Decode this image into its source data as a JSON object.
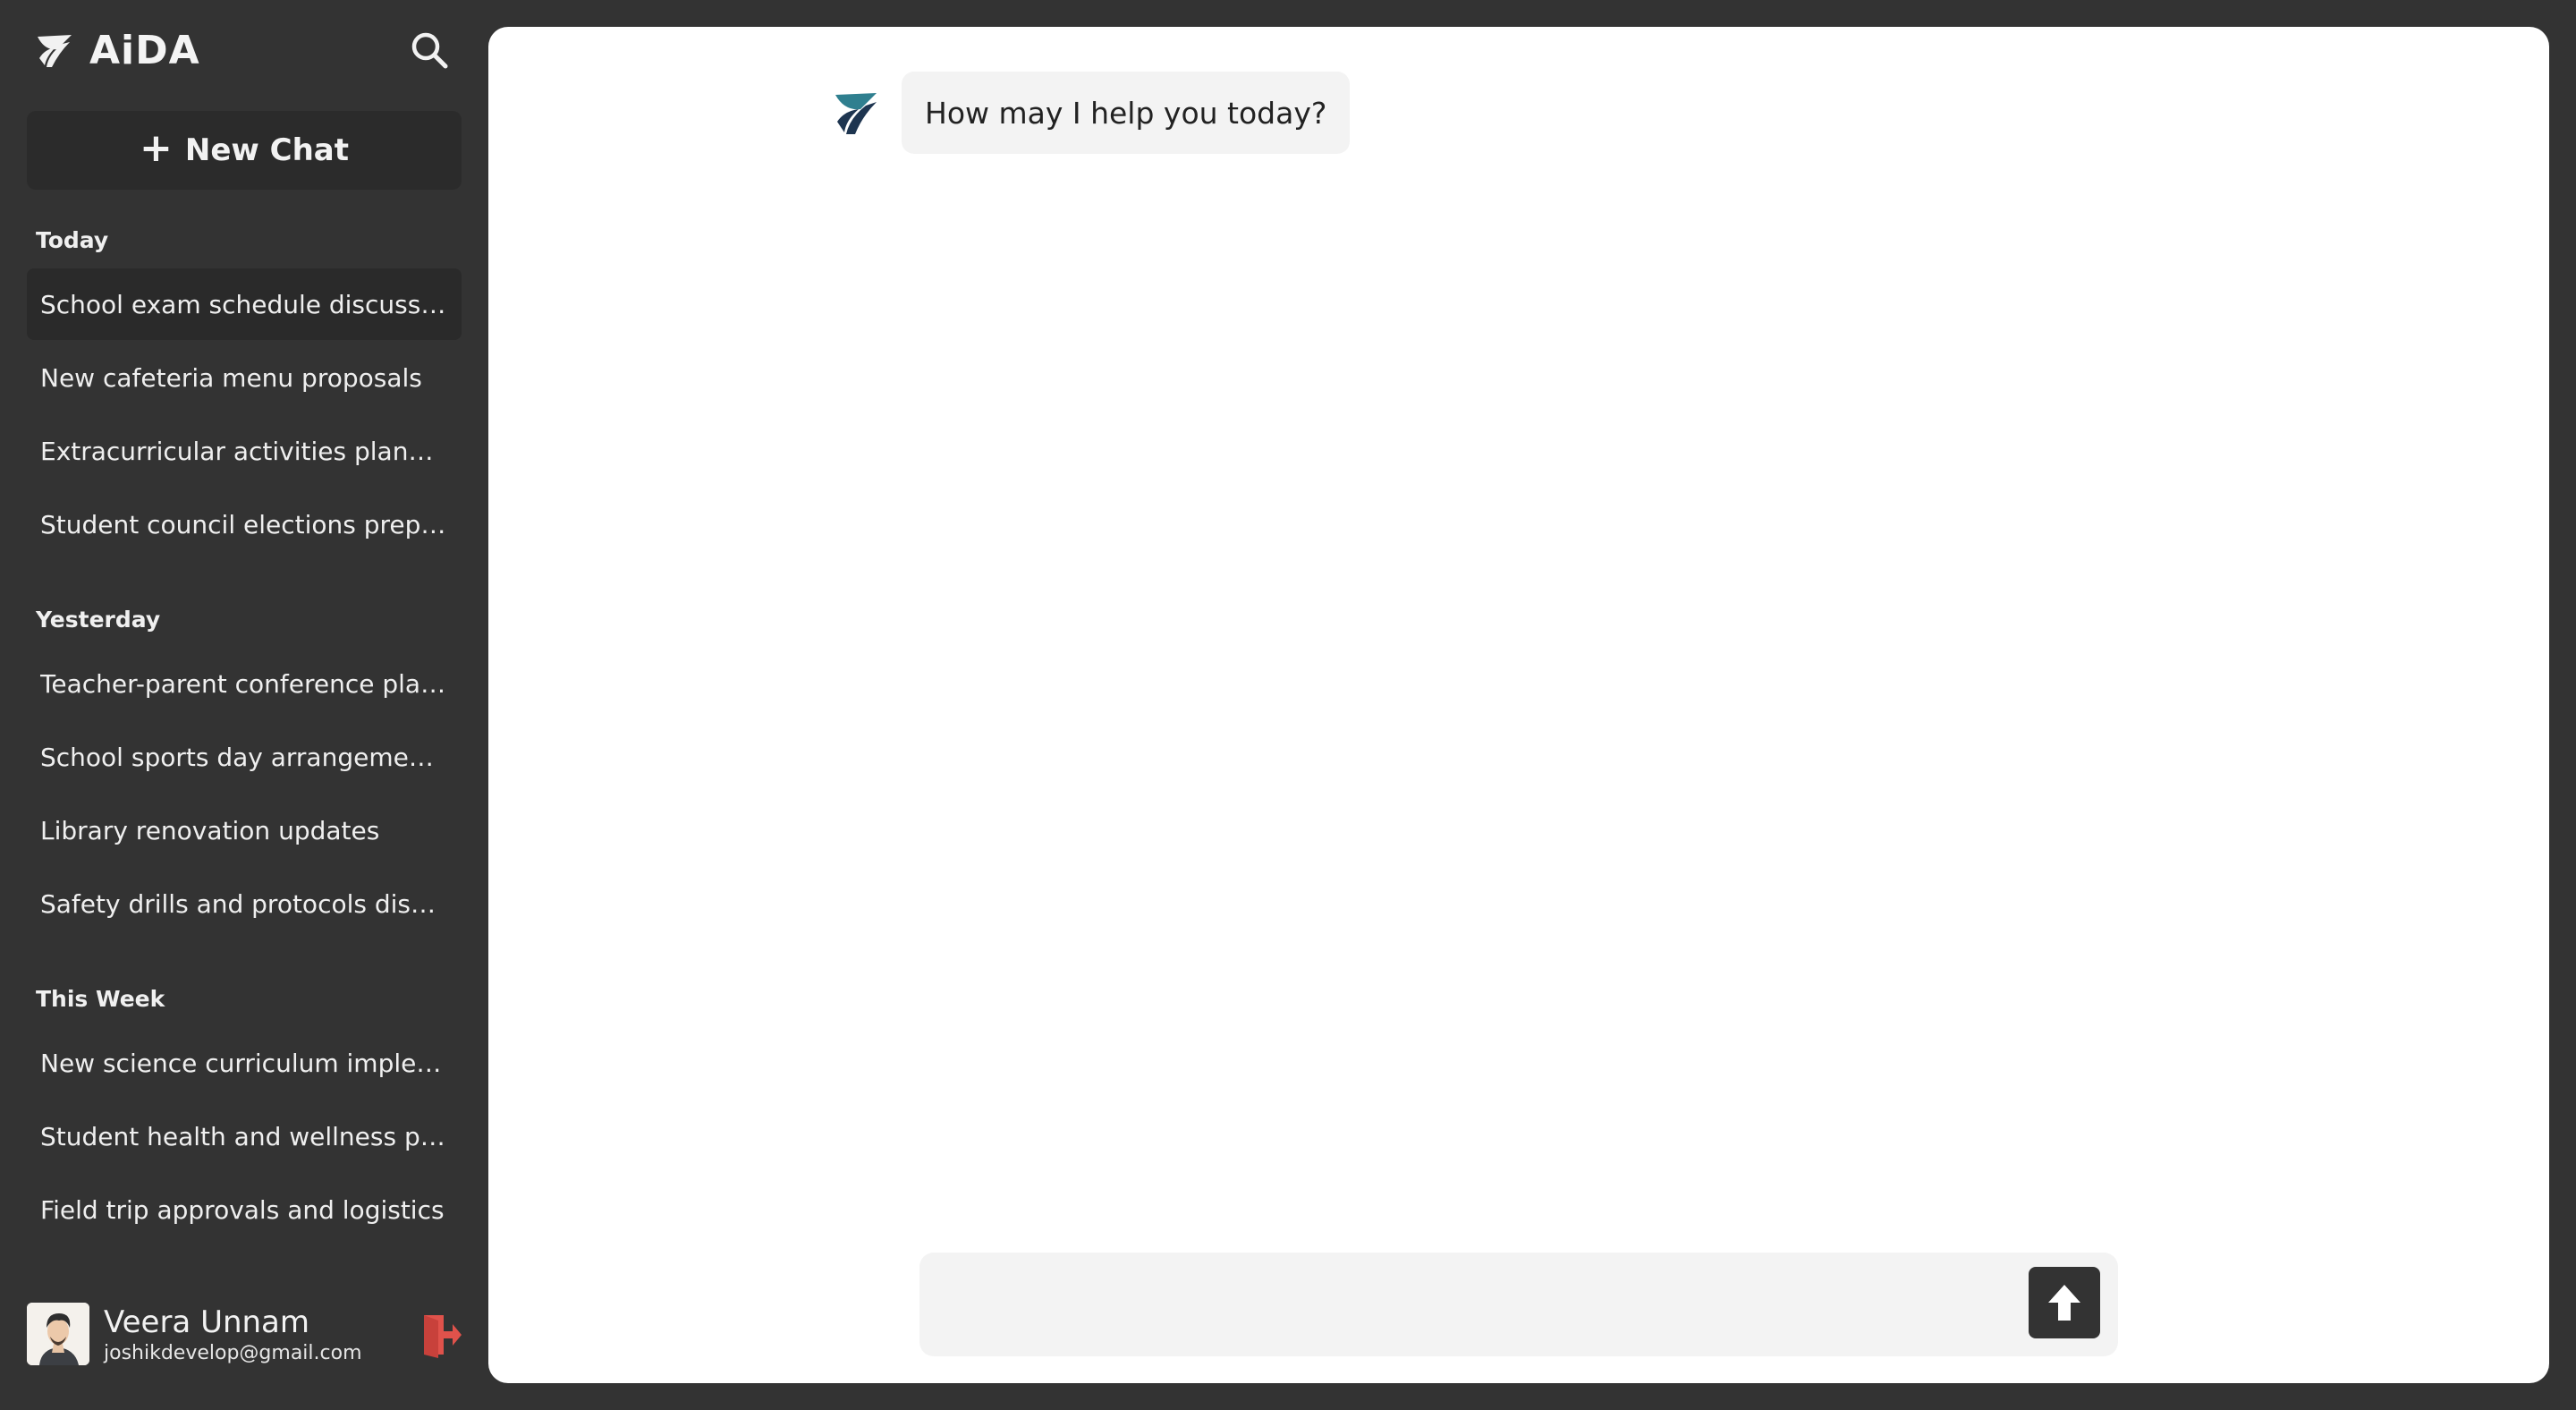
{
  "app": {
    "name": "AiDA"
  },
  "sidebar": {
    "new_chat_label": "New Chat",
    "groups": [
      {
        "title": "Today",
        "items": [
          "School exam schedule discussio…",
          "New cafeteria menu proposals",
          "Extracurricular activities planning",
          "Student council elections prepa…"
        ]
      },
      {
        "title": "Yesterday",
        "items": [
          "Teacher-parent conference plan…",
          "School sports day arrangements",
          "Library renovation updates",
          "Safety drills and protocols discu…"
        ]
      },
      {
        "title": "This Week",
        "items": [
          "New science curriculum implem…",
          "Student health and wellness pro…",
          "Field trip approvals and logistics"
        ]
      }
    ]
  },
  "user": {
    "name": "Veera Unnam",
    "email": "joshikdevelop@gmail.com"
  },
  "chat": {
    "greeting": "How may I help you today?"
  },
  "composer": {
    "placeholder": ""
  },
  "colors": {
    "sidebar_bg": "#333333",
    "panel_bg": "#ffffff",
    "bubble_bg": "#f3f3f3",
    "logout_red": "#e0524b",
    "logo_teal": "#2f7f8f",
    "logo_navy": "#1e3550"
  },
  "icons": {
    "logo": "aida-logo-icon",
    "search": "search-icon",
    "new_chat": "plus-icon",
    "logout": "logout-icon",
    "send": "arrow-up-icon"
  }
}
